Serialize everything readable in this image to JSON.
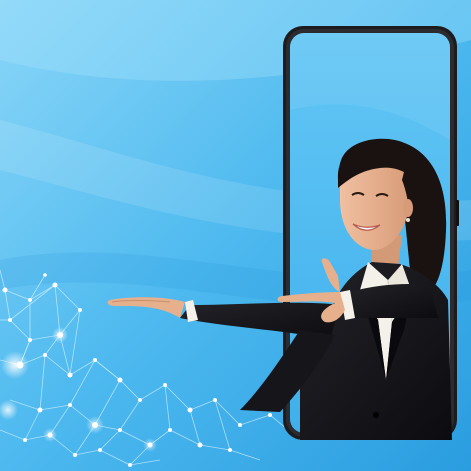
{
  "scene": {
    "background_color_light": "#7fd0f7",
    "background_color_mid": "#4cb9ef",
    "background_color_dark": "#2b9fe0",
    "phone_frame_color": "#1c1c1e",
    "phone_screen_color": "#5ec4f4",
    "suit_color": "#15151a",
    "shirt_color": "#f4f1ea",
    "skin_color": "#e7b08d",
    "hair_color": "#1a1210",
    "network_node_color": "#ffffff"
  }
}
